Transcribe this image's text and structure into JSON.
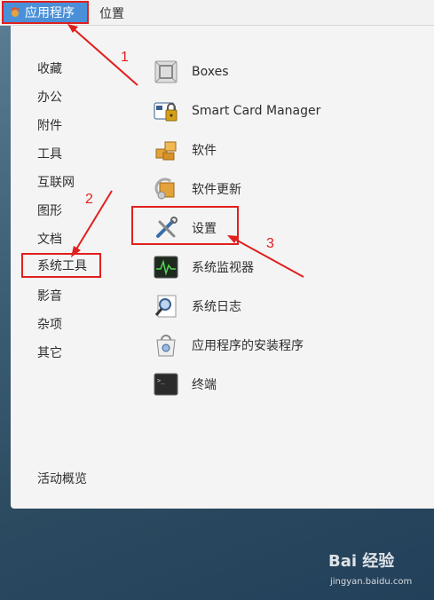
{
  "topbar": {
    "applications_label": "应用程序",
    "places_label": "位置"
  },
  "categories": [
    "收藏",
    "办公",
    "附件",
    "工具",
    "互联网",
    "图形",
    "文档",
    "系统工具",
    "影音",
    "杂项",
    "其它"
  ],
  "selected_category": "系统工具",
  "apps": [
    {
      "label": "Boxes",
      "icon": "boxes-icon"
    },
    {
      "label": "Smart Card Manager",
      "icon": "smart-card-lock-icon"
    },
    {
      "label": "软件",
      "icon": "software-package-icon"
    },
    {
      "label": "软件更新",
      "icon": "software-update-icon"
    },
    {
      "label": "设置",
      "icon": "settings-tools-icon"
    },
    {
      "label": "系统监视器",
      "icon": "system-monitor-icon"
    },
    {
      "label": "系统日志",
      "icon": "system-log-icon"
    },
    {
      "label": "应用程序的安装程序",
      "icon": "app-installer-icon"
    },
    {
      "label": "终端",
      "icon": "terminal-icon"
    }
  ],
  "activities_overview_label": "活动概览",
  "annotations": {
    "step1": "1",
    "step2": "2",
    "step3": "3"
  },
  "watermark": {
    "main": "Bai 经验",
    "sub": "jingyan.baidu.com"
  },
  "colors": {
    "accent": "#4a90d9",
    "annotation_red": "#e0201e",
    "menu_bg": "#f4f4f4"
  }
}
